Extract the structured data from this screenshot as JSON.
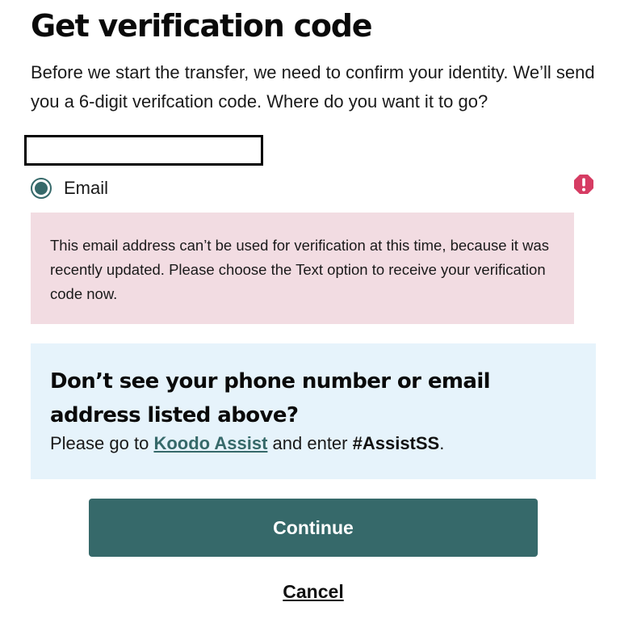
{
  "page": {
    "title": "Get verification code",
    "intro": "Before we start the transfer, we need to confirm your identity. We’ll send you a 6-digit verifcation code. Where do you want it to go?"
  },
  "phone_field": {
    "value": ""
  },
  "email_option": {
    "label": "Email",
    "selected": true,
    "icon": "error-icon"
  },
  "error": {
    "message": "This email address can’t be used for verification at this time, because it was recently updated. Please choose the Text option to receive your verification code now."
  },
  "help": {
    "heading": "Don’t see your phone number or email address listed above?",
    "text_before": "Please go to ",
    "link_label": "Koodo Assist",
    "text_middle": " and enter ",
    "code": "#AssistSS",
    "text_after": "."
  },
  "actions": {
    "continue_label": "Continue",
    "cancel_label": "Cancel"
  },
  "colors": {
    "accent": "#36696a",
    "error_bg": "#f2dce2",
    "info_bg": "#e6f3fb",
    "error_icon": "#d63c63"
  }
}
